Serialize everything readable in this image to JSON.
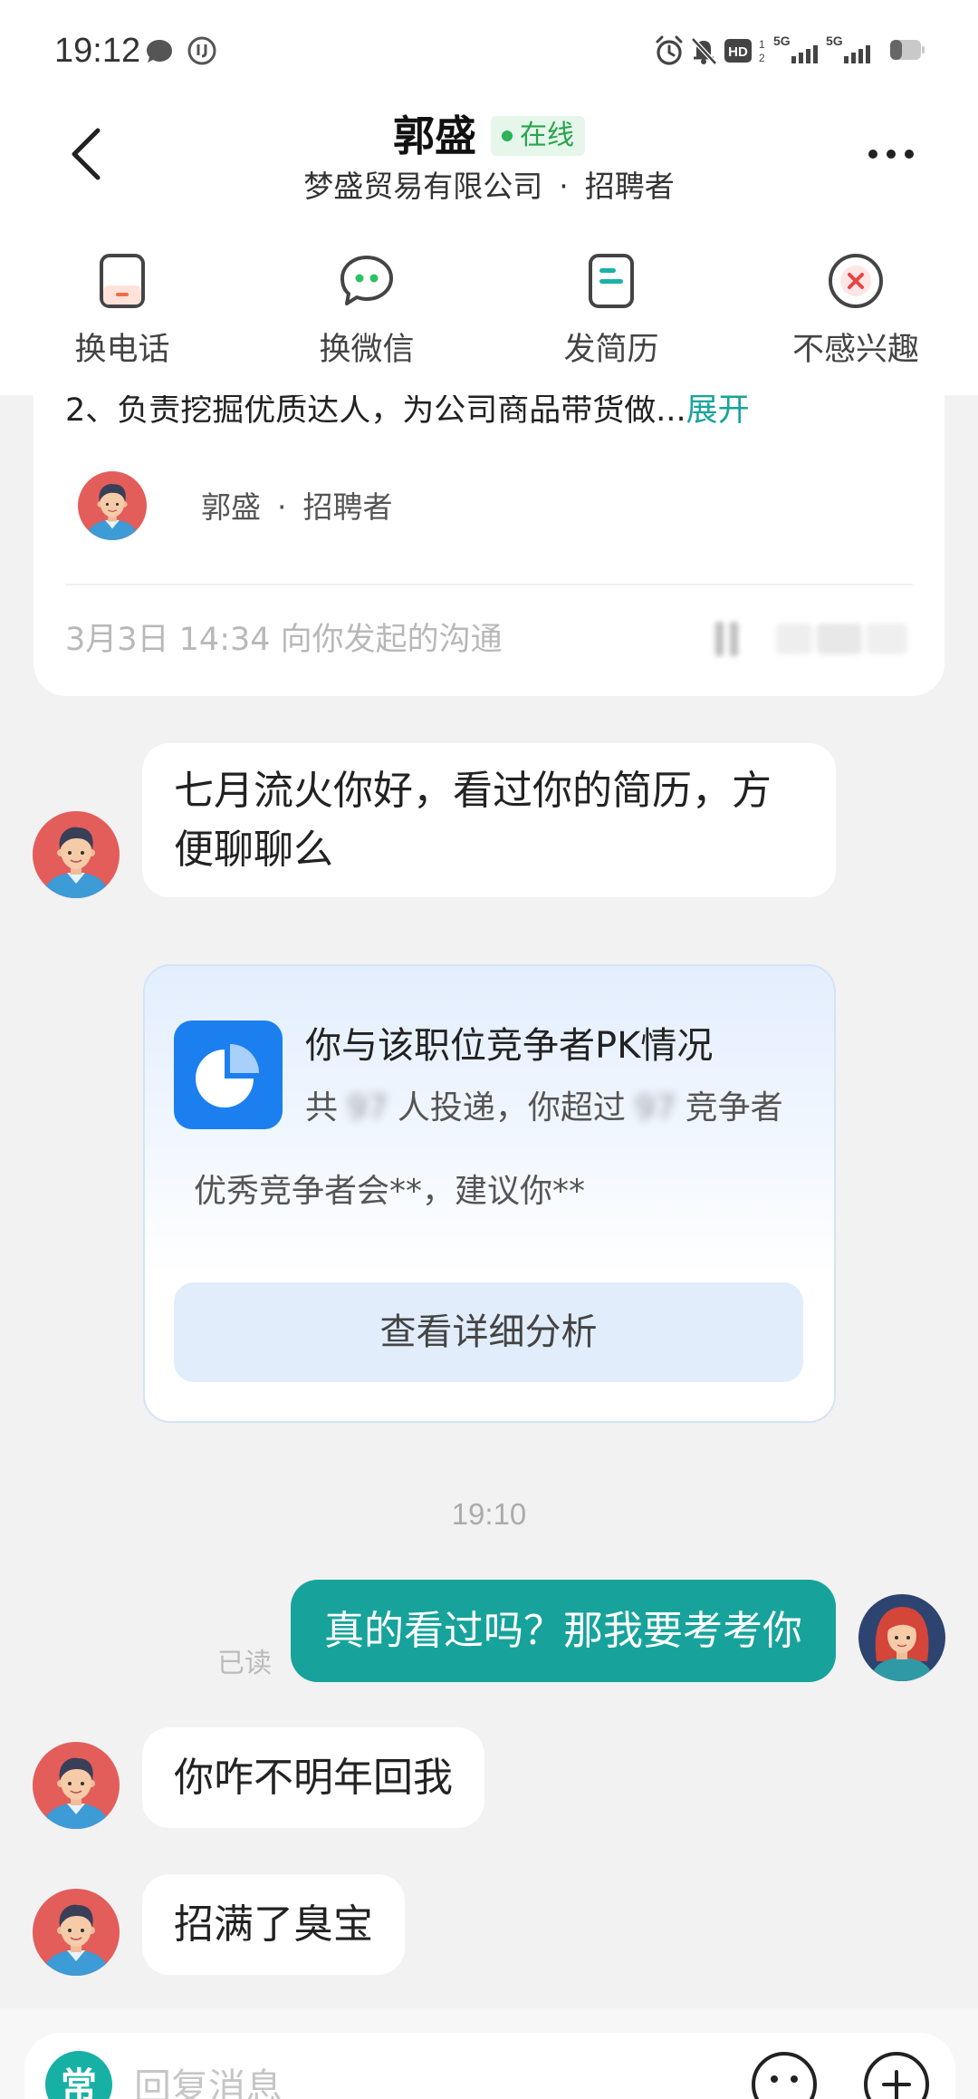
{
  "status_bar": {
    "time": "19:12",
    "left_icons": [
      "message-bubble-icon",
      "app-notification-icon"
    ],
    "right_icons": [
      "alarm-icon",
      "mute-icon",
      "hd-icon",
      "signal-icon",
      "signal-icon",
      "battery-icon"
    ],
    "hd": "HD",
    "hd_sim_top": "1",
    "hd_sim_bottom": "2",
    "network_1": "5G",
    "network_2": "5G"
  },
  "header": {
    "back_icon": "chevron-left-icon",
    "name": "郭盛",
    "online_status": "在线",
    "company": "梦盛贸易有限公司",
    "separator": "·",
    "role": "招聘者",
    "more_icon": "more-icon"
  },
  "actions": [
    {
      "label": "换电话",
      "icon": "phone-swap-icon"
    },
    {
      "label": "换微信",
      "icon": "wechat-swap-icon"
    },
    {
      "label": "发简历",
      "icon": "send-resume-icon"
    },
    {
      "label": "不感兴趣",
      "icon": "not-interested-icon"
    }
  ],
  "job_card": {
    "description": "2、负责挖掘优质达人，为公司商品带货做...",
    "expand": "展开",
    "recruiter_name": "郭盛",
    "separator": "·",
    "recruiter_role": "招聘者",
    "footer": "3月3日 14:34 向你发起的沟通"
  },
  "messages": [
    {
      "text": "七月流火你好，看过你的简历，方便聊聊么"
    },
    {
      "text": "真的看过吗？那我要考考你",
      "status": "已读"
    },
    {
      "text": "你咋不明年回我"
    },
    {
      "text": "招满了臭宝"
    }
  ],
  "pk_card": {
    "icon": "pie-chart-icon",
    "title": "你与该职位竞争者PK情况",
    "prefix": "共",
    "applicants": "97",
    "middle": "人投递，你超过",
    "beaten": "97",
    "suffix": "竞争者",
    "hint": "优秀竞争者会**，建议你**",
    "button": "查看详细分析"
  },
  "timestamp": "19:10",
  "input_bar": {
    "shortcut": "常",
    "placeholder": "回复消息",
    "emoji_icon": "emoji-icon",
    "plus_icon": "plus-icon"
  },
  "colors": {
    "accent": "#17a39b",
    "online": "#2aa34e",
    "pk_blue": "#1b7ff0",
    "background": "#f2f2f2"
  }
}
